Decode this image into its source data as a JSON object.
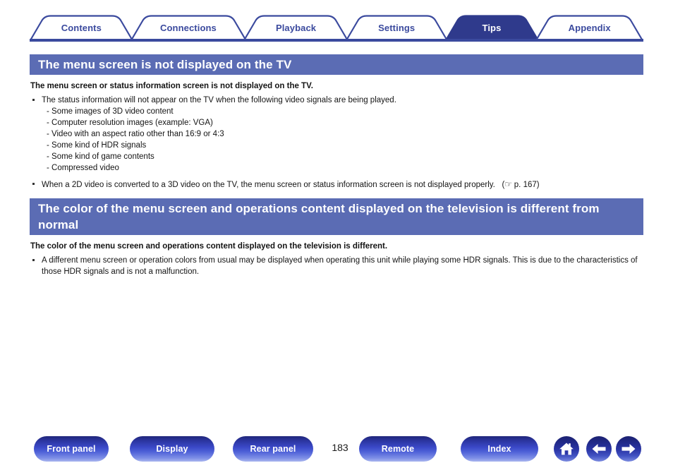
{
  "colors": {
    "tab_active_bg": "#2f3a8c",
    "tab_border": "#3b4a9e",
    "tab_text": "#3b4a9e",
    "tab_active_text": "#ffffff",
    "section_heading_bg": "#5b6cb4",
    "section_heading_text": "#ffffff",
    "body_text": "#141414",
    "button_blue_dark": "#20267a",
    "button_blue_light": "#a9b6ef",
    "rule": "#3b4a9e"
  },
  "tabs": [
    {
      "label": "Contents",
      "active": false
    },
    {
      "label": "Connections",
      "active": false
    },
    {
      "label": "Playback",
      "active": false
    },
    {
      "label": "Settings",
      "active": false
    },
    {
      "label": "Tips",
      "active": true
    },
    {
      "label": "Appendix",
      "active": false
    }
  ],
  "sections": [
    {
      "heading": "The menu screen is not displayed on the TV",
      "lead": "The menu screen or status information screen is not displayed on the TV.",
      "bullets": [
        {
          "text": "The status information will not appear on the TV when the following video signals are being played.",
          "subitems": [
            "- Some images of 3D video content",
            "- Computer resolution images (example: VGA)",
            "- Video with an aspect ratio other than 16:9 or 4:3",
            "- Some kind of HDR signals",
            "- Some kind of game contents",
            "- Compressed video"
          ],
          "reference": null
        },
        {
          "text": "When a 2D video is converted to a 3D video on the TV, the menu screen or status information screen is not displayed properly.",
          "subitems": [],
          "reference": {
            "icon": "pointing-hand-icon",
            "glyph": "☞",
            "page_label": "p. 167",
            "open_paren": "(",
            "close_paren": ")"
          }
        }
      ]
    },
    {
      "heading": "The color of the menu screen and operations content displayed on the television is different from normal",
      "lead": "The color of the menu screen and operations content displayed on the television is different.",
      "bullets": [
        {
          "text": "A different menu screen or operation colors from usual may be displayed when operating this unit while playing some HDR signals. This is due to the characteristics of those HDR signals and is not a malfunction.",
          "subitems": [],
          "reference": null
        }
      ]
    }
  ],
  "footer": {
    "buttons": [
      {
        "label": "Front panel"
      },
      {
        "label": "Display"
      },
      {
        "label": "Rear panel"
      },
      {
        "label": "Remote"
      },
      {
        "label": "Index"
      }
    ],
    "page_number": "183",
    "nav_icons": [
      {
        "name": "home-icon"
      },
      {
        "name": "arrow-left-icon"
      },
      {
        "name": "arrow-right-icon"
      }
    ]
  }
}
